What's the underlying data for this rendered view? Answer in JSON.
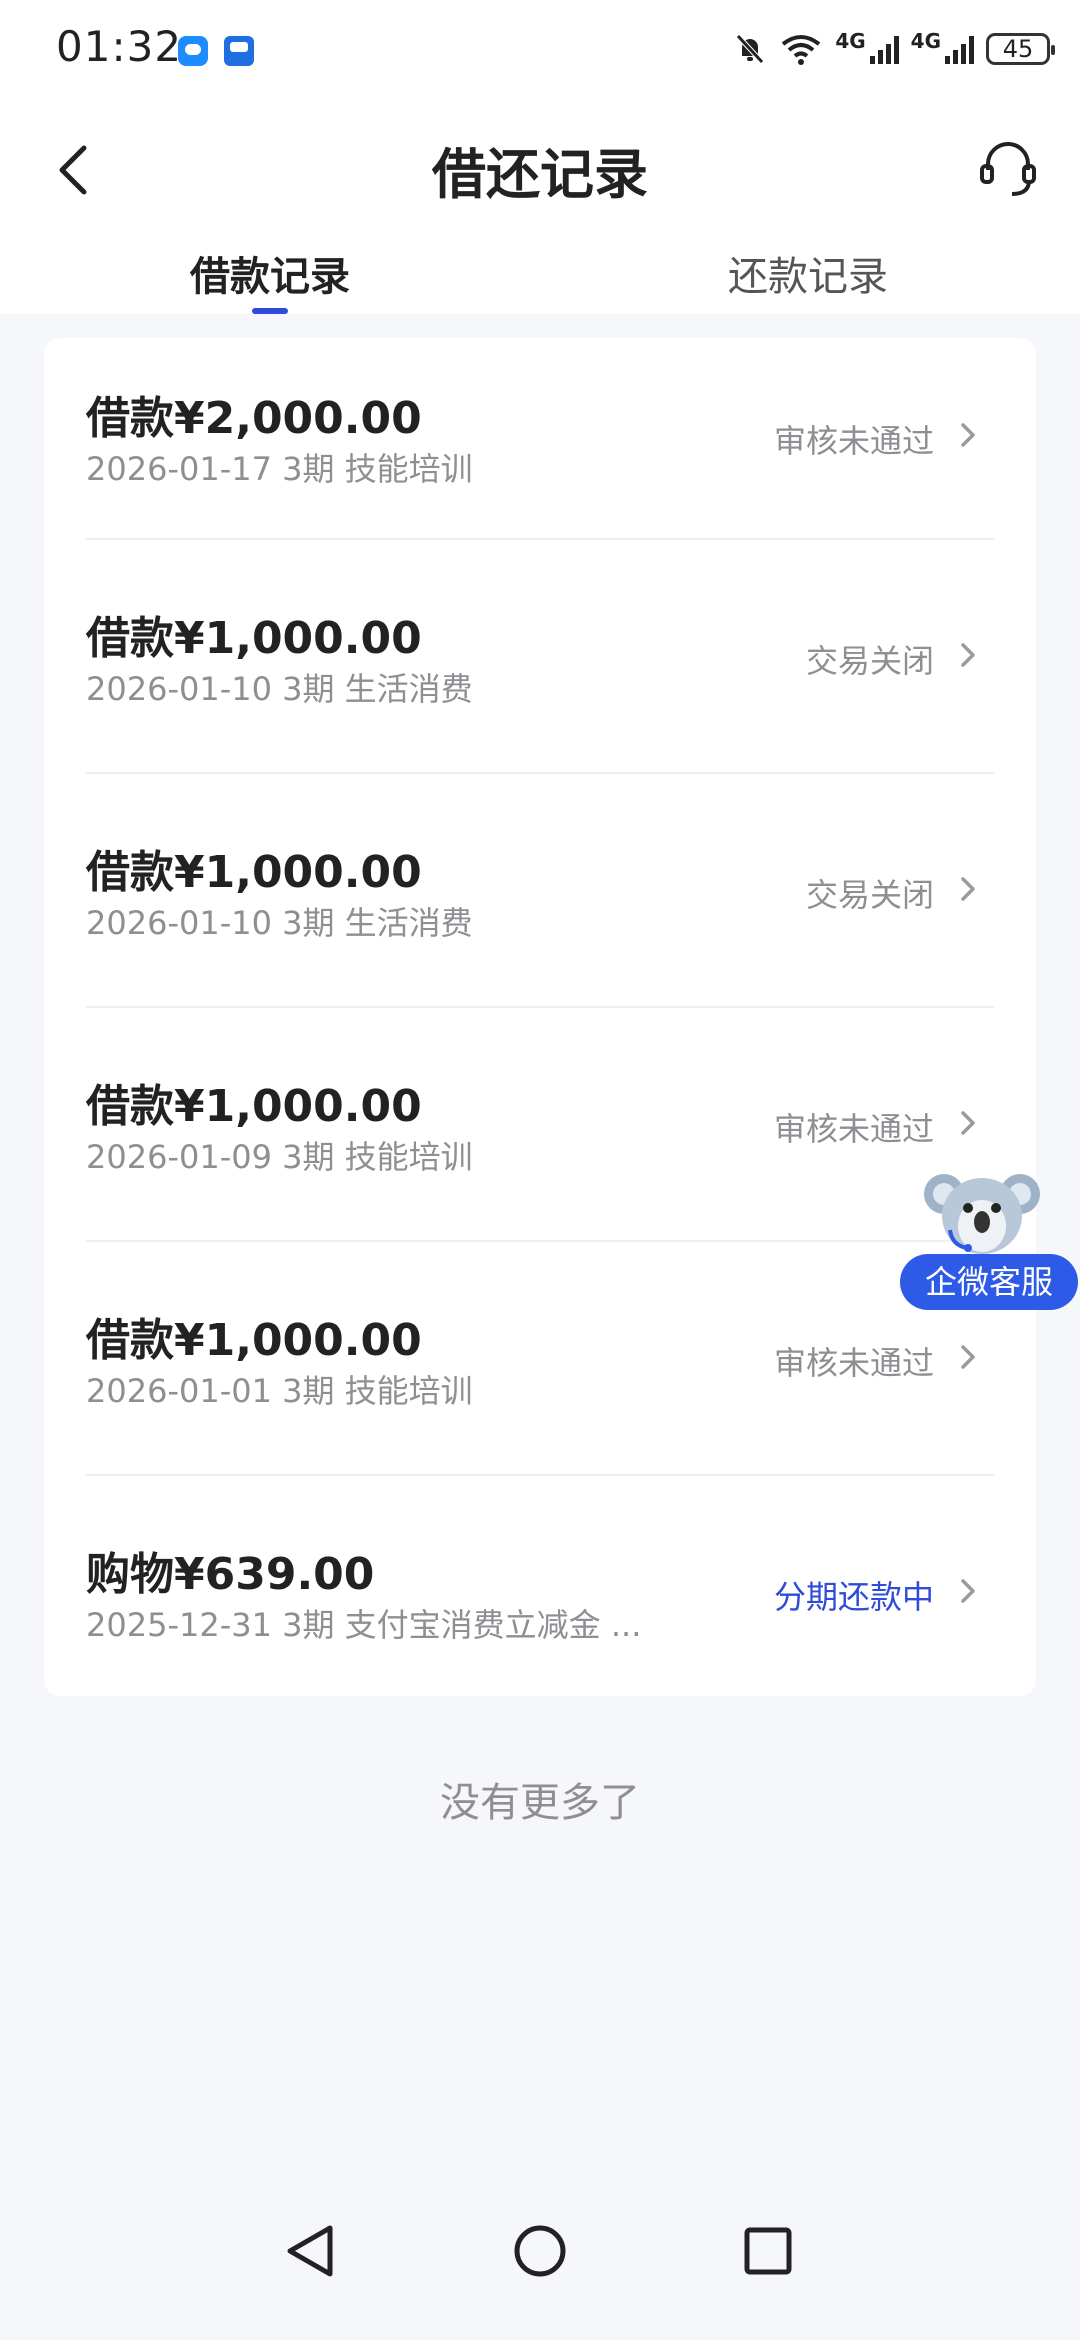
{
  "status_bar": {
    "time": "01:32",
    "network_label_1": "4G",
    "network_label_2": "4G",
    "battery": "45",
    "icons": [
      "message-icon",
      "app-icon",
      "bell-off-icon",
      "wifi-icon",
      "signal-icon",
      "signal-icon",
      "battery-icon"
    ]
  },
  "header": {
    "title": "借还记录",
    "back_icon": "chevron-left-icon",
    "service_icon": "headset-icon"
  },
  "tabs": [
    {
      "label": "借款记录",
      "active": true
    },
    {
      "label": "还款记录",
      "active": false
    }
  ],
  "records": [
    {
      "amount": "借款¥2,000.00",
      "meta": "2026-01-17 3期  技能培训",
      "status": "审核未通过"
    },
    {
      "amount": "借款¥1,000.00",
      "meta": "2026-01-10 3期  生活消费",
      "status": "交易关闭"
    },
    {
      "amount": "借款¥1,000.00",
      "meta": "2026-01-10 3期  生活消费",
      "status": "交易关闭"
    },
    {
      "amount": "借款¥1,000.00",
      "meta": "2026-01-09 3期  技能培训",
      "status": "审核未通过"
    },
    {
      "amount": "借款¥1,000.00",
      "meta": "2026-01-01 3期  技能培训",
      "status": "审核未通过"
    },
    {
      "amount": "购物¥639.00",
      "meta": "2025-12-31 3期  支付宝消费立减金 ...",
      "status": "分期还款中"
    }
  ],
  "footer_text": "没有更多了",
  "floating_service": {
    "label": "企微客服",
    "icon": "koala-mascot-icon"
  },
  "colors": {
    "accent": "#2e4bd9",
    "muted": "#8e8e93",
    "background": "#f6f7fb"
  },
  "nav": {
    "icons": [
      "back-triangle-icon",
      "home-circle-icon",
      "recents-square-icon"
    ]
  }
}
